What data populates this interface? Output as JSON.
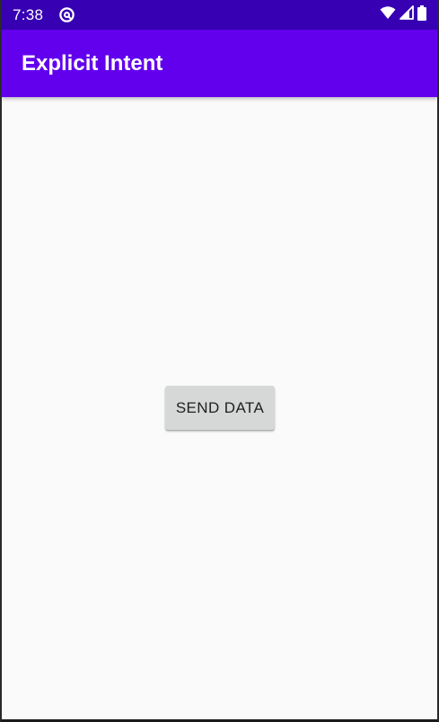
{
  "status_bar": {
    "time": "7:38",
    "notification_icon": "at-sign-icon",
    "wifi_icon": "wifi-icon",
    "signal_icon": "cell-signal-icon",
    "battery_icon": "battery-icon",
    "color": "#3700b3"
  },
  "app_bar": {
    "title": "Explicit Intent",
    "color": "#6200ee"
  },
  "main": {
    "send_button_label": "SEND DATA"
  }
}
